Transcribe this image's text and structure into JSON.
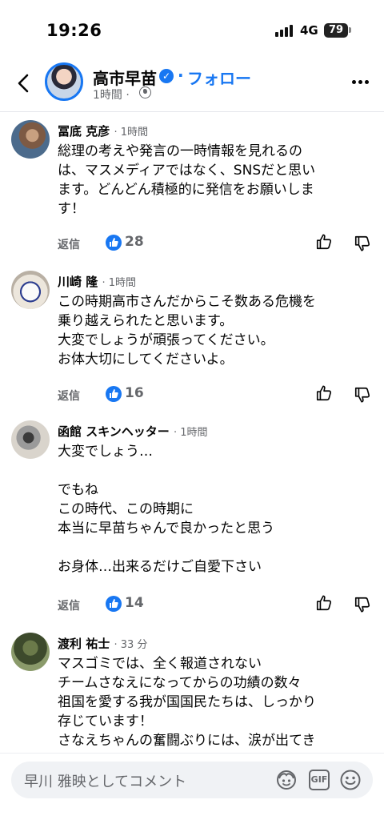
{
  "status_bar": {
    "time": "19:26",
    "network": "4G",
    "battery": "79"
  },
  "header": {
    "page_name": "高市早苗",
    "follow_label": "フォロー",
    "separator": "·",
    "post_time": "1時間 ·"
  },
  "comments": [
    {
      "name": "冨底 克彦",
      "time": "· 1時間",
      "body": "総理の考えや発言の一時情報を見れるの\nは、マスメディアではなく、SNSだと思い\nます。どんどん積極的に発信をお願いしま\nす！",
      "reply_label": "返信",
      "likes": "28"
    },
    {
      "name": "川崎 隆",
      "time": "· 1時間",
      "body": "この時期高市さんだからこそ数ある危機を\n乗り越えられたと思います。\n大変でしょうが頑張ってください。\nお体大切にしてくださいよ。",
      "reply_label": "返信",
      "likes": "16"
    },
    {
      "name": "函館 スキンヘッター",
      "time": "· 1時間",
      "body": "大変でしょう…\n\nでもね\nこの時代、この時期に\n本当に早苗ちゃんで良かったと思う\n\nお身体…出来るだけご自愛下さい",
      "reply_label": "返信",
      "likes": "14"
    },
    {
      "name": "渡利 祐士",
      "time": "· 33 分",
      "body": "マスゴミでは、全く報道されない\nチームさなえになってからの功績の数々\n祖国を愛する我が国国民たちは、しっかり\n存じています！\nさなえちゃんの奮闘ぶりには、涙が出てき"
    }
  ],
  "composer": {
    "placeholder": "早川 雅映としてコメント",
    "gif_label": "GIF"
  },
  "colors": {
    "accent": "#1877f2",
    "secondary_text": "#65676b"
  }
}
